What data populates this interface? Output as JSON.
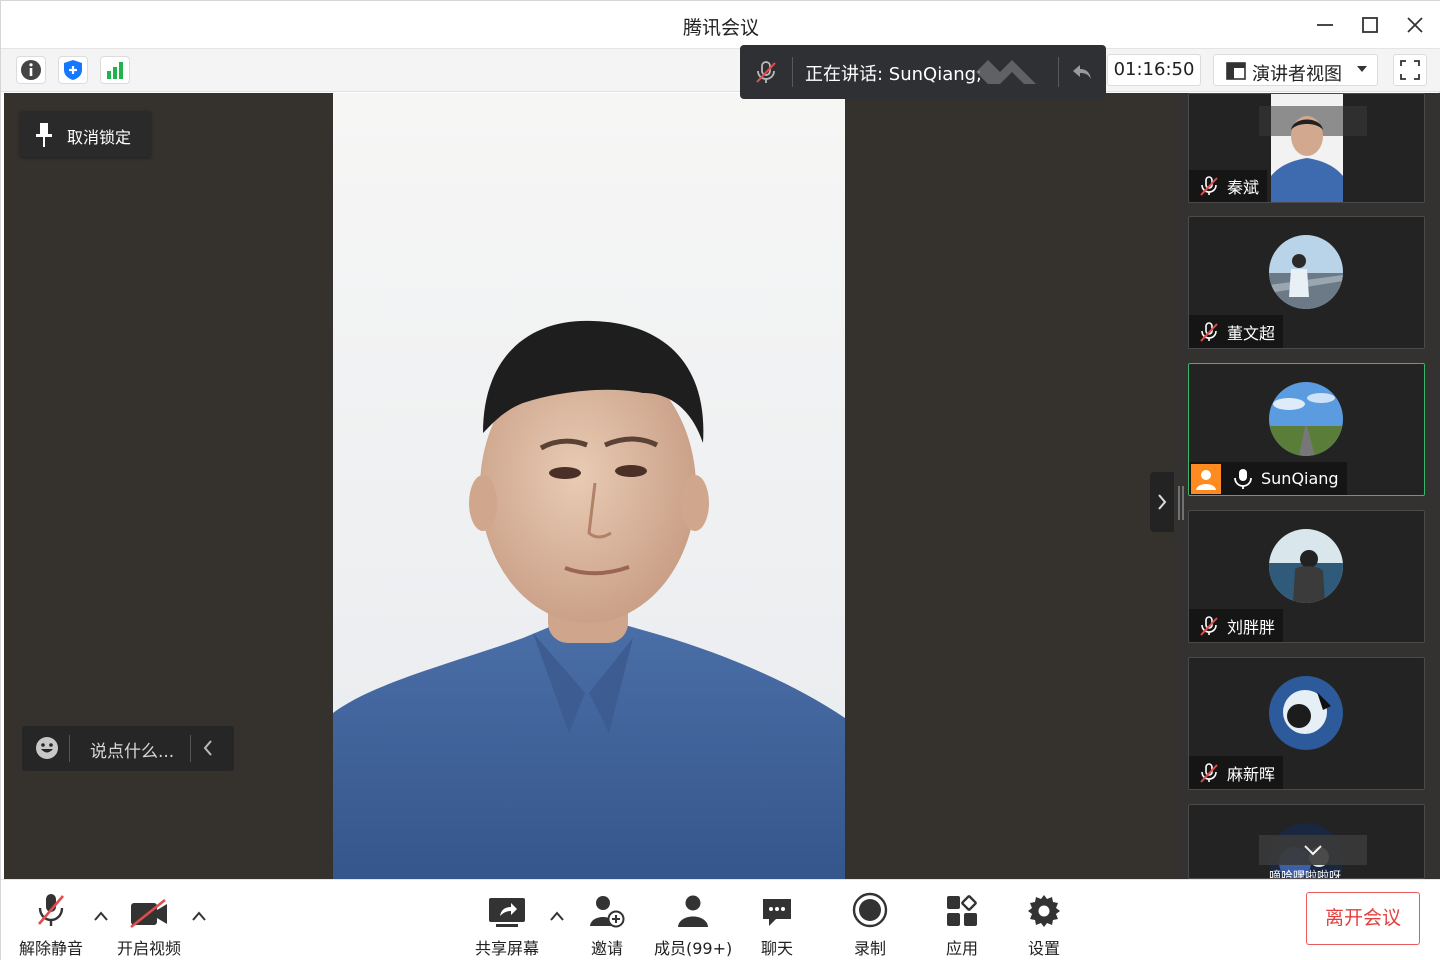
{
  "window": {
    "title": "腾讯会议"
  },
  "toolbar": {
    "speaking_label": "正在讲话: SunQiang;",
    "timer": "01:16:50",
    "view_label": "演讲者视图"
  },
  "stage": {
    "unpin_label": "取消锁定",
    "chat_placeholder": "说点什么..."
  },
  "participants": [
    {
      "name": "秦斌",
      "mic": "muted"
    },
    {
      "name": "董文超",
      "mic": "muted"
    },
    {
      "name": "SunQiang",
      "mic": "on",
      "active": true
    },
    {
      "name": "刘胖胖",
      "mic": "muted"
    },
    {
      "name": "麻新晖",
      "mic": "muted"
    },
    {
      "name": "嘀哈嘿啦啦呀",
      "mic": "muted"
    }
  ],
  "controls": {
    "unmute": "解除静音",
    "start_video": "开启视频",
    "share_screen": "共享屏幕",
    "invite": "邀请",
    "members": "成员(99+)",
    "chat": "聊天",
    "record": "录制",
    "apps": "应用",
    "settings": "设置",
    "leave": "离开会议"
  },
  "colors": {
    "stage_bg": "#35312d",
    "active_border": "#3bb56a",
    "leave_red": "#e53e3e",
    "signal_green": "#1fb34b",
    "shield_blue": "#1677ff"
  }
}
